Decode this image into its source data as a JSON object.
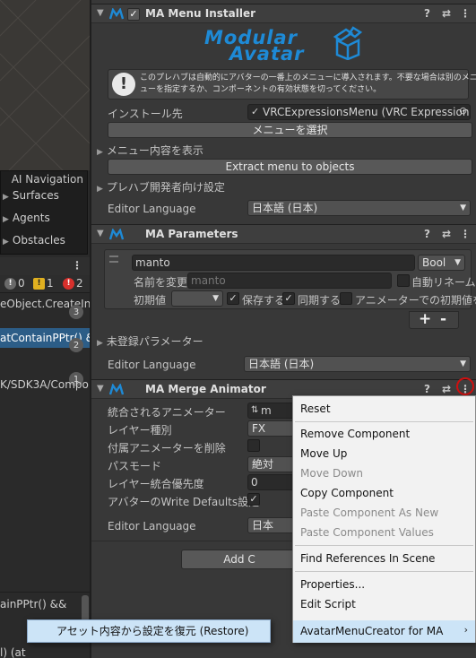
{
  "left": {
    "ai_navigation": {
      "title": "AI Navigation",
      "items": [
        "Surfaces",
        "Agents",
        "Obstacles"
      ]
    },
    "console": {
      "counts": {
        "info": "0",
        "warning": "1",
        "error": "2"
      },
      "logs": [
        {
          "text": "eObject.CreateInst",
          "count": "3"
        },
        {
          "text": "atContainPPtr() &&",
          "count": "2"
        },
        {
          "text": "K/SDK3A/Compo",
          "count": "1"
        },
        {
          "text": "ainPPtr() &&",
          "count": ""
        }
      ],
      "bottom_text": "l) (at"
    }
  },
  "inspector": {
    "installer": {
      "title": "MA Menu Installer",
      "logo_text": [
        "Modular",
        "Avatar"
      ],
      "help_text_line1": "このプレハブは自動的にアバターの一番上のメニューに導入されます。不要な場合は別のメニ",
      "help_text_line2": "ューを指定するか、コンポーネントの有効状態を切ってください。",
      "install_to_label": "インストール先",
      "install_to_value": "VRCExpressionsMenu (VRC Expression",
      "select_menu_button": "メニューを選択",
      "show_menu_label": "メニュー内容を表示",
      "extract_button": "Extract menu to objects",
      "prefab_dev_label": "プレハブ開発者向け設定",
      "editor_language_label": "Editor Language",
      "editor_language_value": "日本語 (日本)"
    },
    "parameters": {
      "title": "MA Parameters",
      "param_name": "manto",
      "param_type": "Bool",
      "rename_label": "名前を変更",
      "rename_placeholder": "manto",
      "auto_rename_label": "自動リネーム",
      "default_label": "初期値",
      "saved_label": "保存する",
      "synced_label": "同期する",
      "animator_default_label": "アニメーターでの初期値を設定",
      "unregistered_label": "未登録パラメーター",
      "editor_language_label": "Editor Language",
      "editor_language_value": "日本語 (日本)",
      "plus": "+",
      "minus": "-"
    },
    "merge_animator": {
      "title": "MA Merge Animator",
      "rows": [
        {
          "label": "統合されるアニメーター",
          "value": "m"
        },
        {
          "label": "レイヤー種別",
          "value": "FX"
        },
        {
          "label": "付属アニメーターを削除",
          "value": ""
        },
        {
          "label": "パスモード",
          "value": "絶対"
        },
        {
          "label": "レイヤー統合優先度",
          "value": "0"
        },
        {
          "label": "アバターのWrite Defaults設定",
          "value": "✓"
        }
      ],
      "editor_language_label": "Editor Language",
      "editor_language_value": "日本",
      "add_button": "Add C"
    }
  },
  "context_menu": {
    "items": [
      {
        "label": "Reset",
        "enabled": true
      },
      {
        "label": "Remove Component",
        "enabled": true
      },
      {
        "label": "Move Up",
        "enabled": true
      },
      {
        "label": "Move Down",
        "enabled": false
      },
      {
        "label": "Copy Component",
        "enabled": true
      },
      {
        "label": "Paste Component As New",
        "enabled": false
      },
      {
        "label": "Paste Component Values",
        "enabled": false
      },
      {
        "label": "Find References In Scene",
        "enabled": true
      },
      {
        "label": "Properties...",
        "enabled": true
      },
      {
        "label": "Edit Script",
        "enabled": true
      },
      {
        "label": "AvatarMenuCreator for MA",
        "enabled": true
      }
    ],
    "submenu_arrow": "›"
  },
  "submenu": {
    "label": "アセット内容から設定を復元 (Restore)"
  },
  "colors": {
    "accent_blue": "#1e8ad6",
    "highlight": "#cce4f7",
    "error_red": "#d01010",
    "warning_yellow": "#e0b020"
  }
}
